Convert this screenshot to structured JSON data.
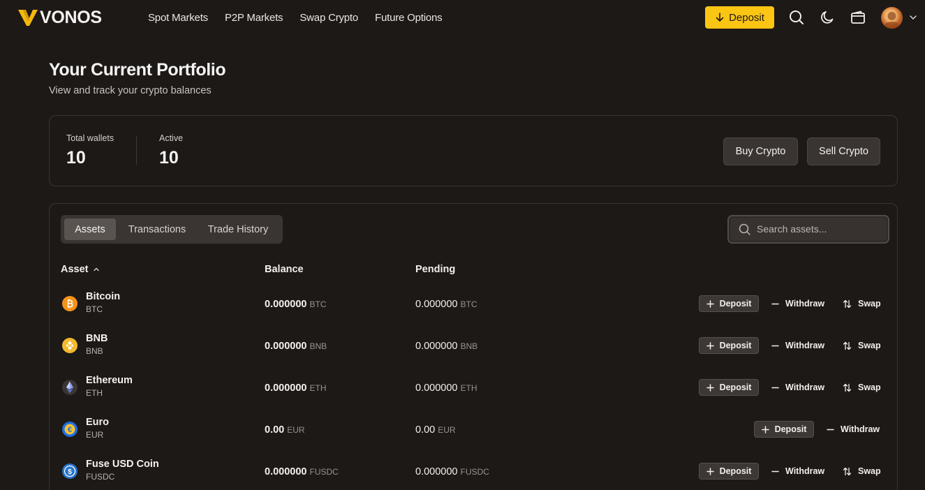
{
  "brand": {
    "name": "VONOS",
    "accent": "#fbc514"
  },
  "nav": [
    {
      "label": "Spot Markets"
    },
    {
      "label": "P2P Markets"
    },
    {
      "label": "Swap Crypto"
    },
    {
      "label": "Future Options"
    }
  ],
  "header": {
    "deposit_label": "Deposit",
    "icons": [
      "search-icon",
      "moon-icon",
      "wallet-icon",
      "avatar",
      "chevron-down-icon"
    ]
  },
  "page": {
    "title": "Your Current Portfolio",
    "subtitle": "View and track your crypto balances"
  },
  "stats": {
    "total_wallets_label": "Total wallets",
    "total_wallets_value": "10",
    "active_label": "Active",
    "active_value": "10",
    "buy_label": "Buy Crypto",
    "sell_label": "Sell Crypto"
  },
  "tabs": [
    {
      "label": "Assets",
      "active": true
    },
    {
      "label": "Transactions",
      "active": false
    },
    {
      "label": "Trade History",
      "active": false
    }
  ],
  "search": {
    "placeholder": "Search assets..."
  },
  "table": {
    "headers": {
      "asset": "Asset",
      "balance": "Balance",
      "pending": "Pending"
    },
    "actions": {
      "deposit": "Deposit",
      "withdraw": "Withdraw",
      "swap": "Swap"
    },
    "rows": [
      {
        "name": "Bitcoin",
        "symbol": "BTC",
        "balance": "0.000000",
        "pending": "0.000000",
        "icon": "bitcoin-icon",
        "color": "#f7931a",
        "swap": true
      },
      {
        "name": "BNB",
        "symbol": "BNB",
        "balance": "0.000000",
        "pending": "0.000000",
        "icon": "bnb-icon",
        "color": "#f3ba2f",
        "swap": true
      },
      {
        "name": "Ethereum",
        "symbol": "ETH",
        "balance": "0.000000",
        "pending": "0.000000",
        "icon": "ethereum-icon",
        "color": "#627eea",
        "swap": true
      },
      {
        "name": "Euro",
        "symbol": "EUR",
        "balance": "0.00",
        "pending": "0.00",
        "icon": "euro-icon",
        "color": "#1f6fe0",
        "swap": false
      },
      {
        "name": "Fuse USD Coin",
        "symbol": "FUSDC",
        "balance": "0.000000",
        "pending": "0.000000",
        "icon": "usdc-icon",
        "color": "#2775ca",
        "swap": true
      }
    ]
  }
}
